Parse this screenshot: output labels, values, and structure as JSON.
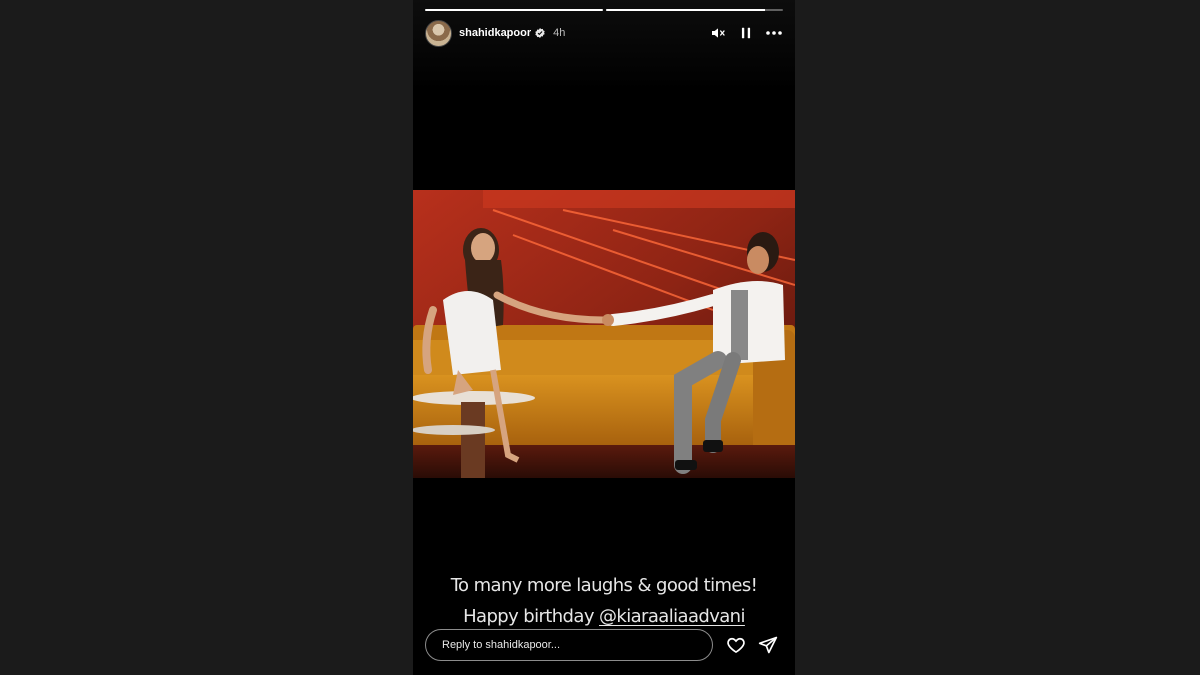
{
  "story": {
    "username": "shahidkapoor",
    "time_ago": "4h",
    "verified": true,
    "progress_segments": [
      1.0,
      0.9
    ]
  },
  "header_icons": {
    "mute": "speaker-muted-icon",
    "pause": "pause-icon",
    "more": "more-options-icon"
  },
  "caption": {
    "line1": "To many more laughs & good times!",
    "line2_prefix": "Happy birthday ",
    "mention": "@kiaraaliaadvani"
  },
  "reply": {
    "placeholder": "Reply to shahidkapoor..."
  },
  "footer_icons": {
    "like": "heart-icon",
    "share": "send-icon"
  },
  "colors": {
    "page_background": "#1b1b1b",
    "story_background": "#000000",
    "text": "#ffffff"
  }
}
